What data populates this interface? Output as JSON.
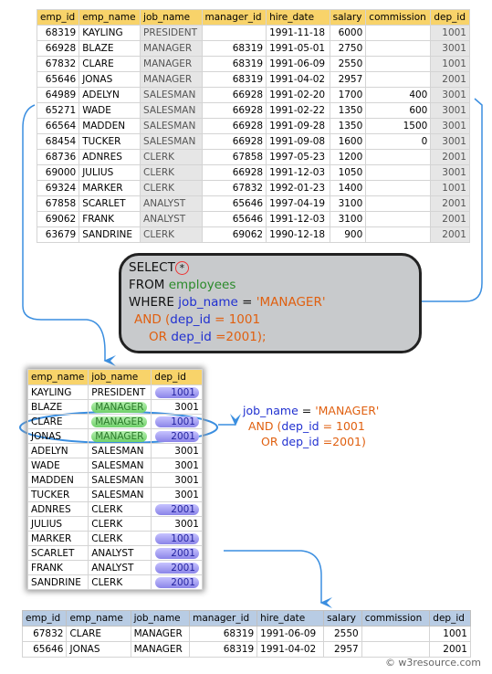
{
  "employees": {
    "columns": [
      "emp_id",
      "emp_name",
      "job_name",
      "manager_id",
      "hire_date",
      "salary",
      "commission",
      "dep_id"
    ],
    "rows": [
      [
        "68319",
        "KAYLING",
        "PRESIDENT",
        "",
        "1991-11-18",
        "6000",
        "",
        "1001"
      ],
      [
        "66928",
        "BLAZE",
        "MANAGER",
        "68319",
        "1991-05-01",
        "2750",
        "",
        "3001"
      ],
      [
        "67832",
        "CLARE",
        "MANAGER",
        "68319",
        "1991-06-09",
        "2550",
        "",
        "1001"
      ],
      [
        "65646",
        "JONAS",
        "MANAGER",
        "68319",
        "1991-04-02",
        "2957",
        "",
        "2001"
      ],
      [
        "64989",
        "ADELYN",
        "SALESMAN",
        "66928",
        "1991-02-20",
        "1700",
        "400",
        "3001"
      ],
      [
        "65271",
        "WADE",
        "SALESMAN",
        "66928",
        "1991-02-22",
        "1350",
        "600",
        "3001"
      ],
      [
        "66564",
        "MADDEN",
        "SALESMAN",
        "66928",
        "1991-09-28",
        "1350",
        "1500",
        "3001"
      ],
      [
        "68454",
        "TUCKER",
        "SALESMAN",
        "66928",
        "1991-09-08",
        "1600",
        "0",
        "3001"
      ],
      [
        "68736",
        "ADNRES",
        "CLERK",
        "67858",
        "1997-05-23",
        "1200",
        "",
        "2001"
      ],
      [
        "69000",
        "JULIUS",
        "CLERK",
        "66928",
        "1991-12-03",
        "1050",
        "",
        "3001"
      ],
      [
        "69324",
        "MARKER",
        "CLERK",
        "67832",
        "1992-01-23",
        "1400",
        "",
        "1001"
      ],
      [
        "67858",
        "SCARLET",
        "ANALYST",
        "65646",
        "1997-04-19",
        "3100",
        "",
        "2001"
      ],
      [
        "69062",
        "FRANK",
        "ANALYST",
        "65646",
        "1991-12-03",
        "3100",
        "",
        "2001"
      ],
      [
        "63679",
        "SANDRINE",
        "CLERK",
        "69062",
        "1990-12-18",
        "900",
        "",
        "2001"
      ]
    ]
  },
  "sql": {
    "select": "SELECT",
    "star": "*",
    "from": "FROM",
    "table": "employees",
    "where": "WHERE",
    "col1": "job_name",
    "eq1": " = ",
    "val1": "'MANAGER'",
    "and": "AND (",
    "col2": "dep_id",
    "eq2": " = 1001",
    "or": "OR ",
    "col3": "dep_id",
    "eq3": " =2001);"
  },
  "filter": {
    "columns": [
      "emp_name",
      "job_name",
      "dep_id"
    ]
  },
  "side": {
    "col1": "job_name",
    "eq1": " = ",
    "val1": "'MANAGER'",
    "and": "AND (",
    "col2": "dep_id",
    "eq2": " = 1001",
    "or": "OR ",
    "col3": "dep_id",
    "eq3": " =2001)"
  },
  "result": {
    "columns": [
      "emp_id",
      "emp_name",
      "job_name",
      "manager_id",
      "hire_date",
      "salary",
      "commission",
      "dep_id"
    ],
    "rows": [
      [
        "67832",
        "CLARE",
        "MANAGER",
        "68319",
        "1991-06-09",
        "2550",
        "",
        "1001"
      ],
      [
        "65646",
        "JONAS",
        "MANAGER",
        "68319",
        "1991-04-02",
        "2957",
        "",
        "2001"
      ]
    ]
  },
  "watermark": "© w3resource.com",
  "colors": {
    "header": "#f8d36a",
    "result_header": "#b8cce4",
    "arrow": "#3a8ee0",
    "manager_pill": "#6fd069",
    "dep_pill": "#8a84e8"
  }
}
